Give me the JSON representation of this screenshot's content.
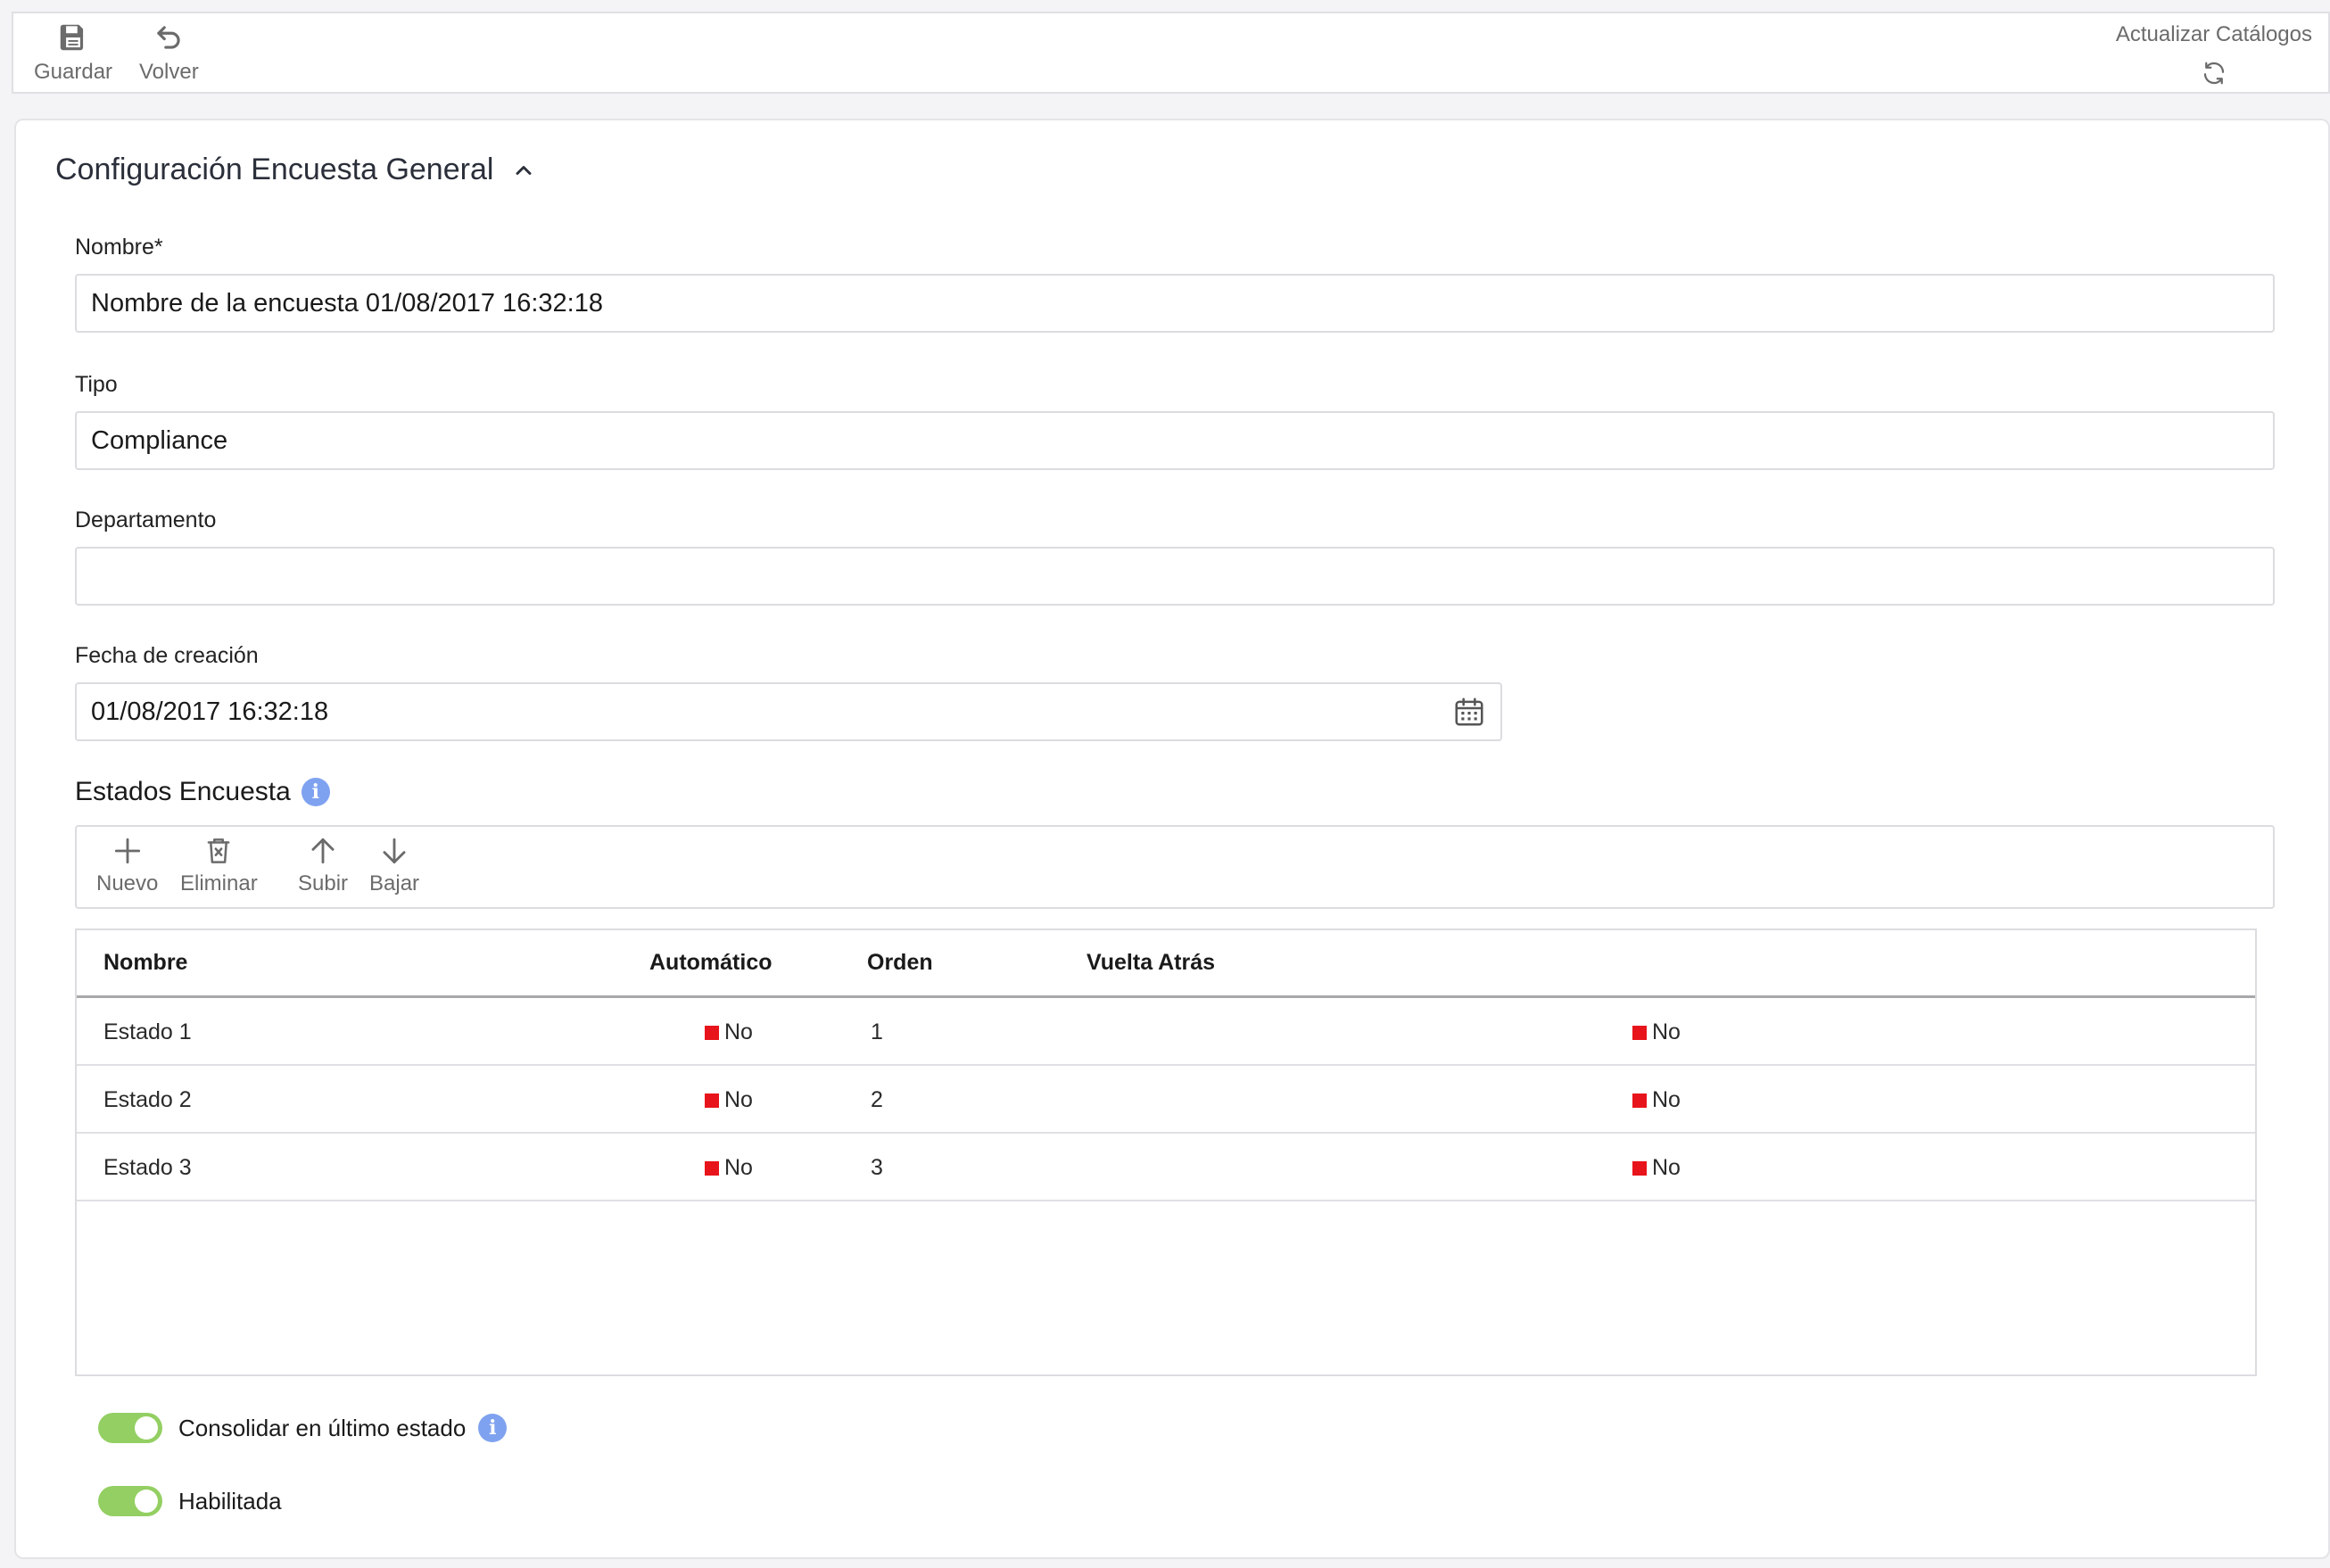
{
  "toolbar": {
    "save_label": "Guardar",
    "back_label": "Volver",
    "refresh_label": "Actualizar Catálogos"
  },
  "panel": {
    "title": "Configuración Encuesta General"
  },
  "form": {
    "nombre_label": "Nombre*",
    "nombre_value": "Nombre de la encuesta 01/08/2017 16:32:18",
    "tipo_label": "Tipo",
    "tipo_value": "Compliance",
    "departamento_label": "Departamento",
    "departamento_value": "",
    "fecha_label": "Fecha de creación",
    "fecha_value": "01/08/2017 16:32:18"
  },
  "estados": {
    "title": "Estados Encuesta",
    "info_glyph": "i",
    "toolbar": {
      "new_label": "Nuevo",
      "delete_label": "Eliminar",
      "up_label": "Subir",
      "down_label": "Bajar"
    },
    "columns": [
      "Nombre",
      "Automático",
      "Orden",
      "Vuelta Atrás"
    ],
    "rows": [
      {
        "nombre": "Estado 1",
        "automatico": "No",
        "orden": "1",
        "vuelta": "No"
      },
      {
        "nombre": "Estado 2",
        "automatico": "No",
        "orden": "2",
        "vuelta": "No"
      },
      {
        "nombre": "Estado 3",
        "automatico": "No",
        "orden": "3",
        "vuelta": "No"
      }
    ]
  },
  "toggles": {
    "consolidar_label": "Consolidar en último estado",
    "consolidar_on": true,
    "habilitada_label": "Habilitada",
    "habilitada_on": true
  },
  "colors": {
    "accent_toggle": "#93cf62",
    "info": "#7fa2f0",
    "status_no": "#e8141b"
  }
}
